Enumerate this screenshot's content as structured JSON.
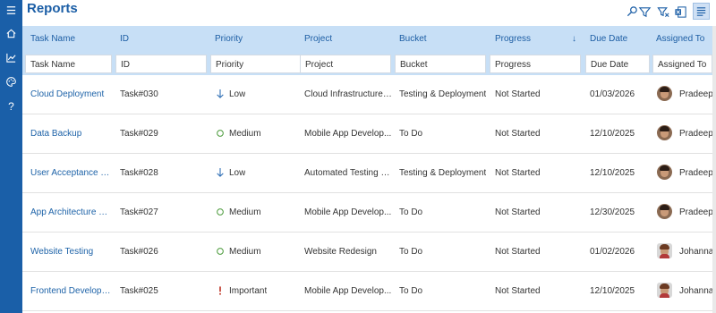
{
  "app": {
    "title": "Reports"
  },
  "rail": {
    "icons": [
      "menu-icon",
      "chart-icon",
      "palette-icon",
      "help-icon"
    ]
  },
  "toolbar": {
    "icons": [
      "search-filter-icon",
      "filter-clear-icon",
      "export-excel-icon",
      "view-toggle-icon"
    ]
  },
  "columns": [
    {
      "key": "task_name",
      "label": "Task Name",
      "filter_placeholder": "Task Name"
    },
    {
      "key": "id",
      "label": "ID",
      "filter_placeholder": "ID"
    },
    {
      "key": "priority",
      "label": "Priority",
      "filter_placeholder": "Priority"
    },
    {
      "key": "project",
      "label": "Project",
      "filter_placeholder": "Project"
    },
    {
      "key": "bucket",
      "label": "Bucket",
      "filter_placeholder": "Bucket"
    },
    {
      "key": "progress",
      "label": "Progress",
      "filter_placeholder": "Progress",
      "sort_indicator": "↓"
    },
    {
      "key": "due_date",
      "label": "Due Date",
      "filter_placeholder": "Due Date"
    },
    {
      "key": "assigned_to",
      "label": "Assigned To",
      "filter_placeholder": "Assigned To"
    }
  ],
  "colors": {
    "brand": "#1b5ea6",
    "header_bg": "#c7dff6",
    "low": "#2f6fb5",
    "medium": "#4a9a3a",
    "important": "#c0392b"
  },
  "rows": [
    {
      "task_name": "Cloud Deployment",
      "id": "Task#030",
      "priority": "Low",
      "priority_icon": "arrow-down-icon",
      "project": "Cloud Infrastructure ...",
      "bucket": "Testing & Deployment",
      "progress": "Not Started",
      "due_date": "01/03/2026",
      "assigned_to": "Pradeep C",
      "avatar": "pradeep"
    },
    {
      "task_name": "Data Backup",
      "id": "Task#029",
      "priority": "Medium",
      "priority_icon": "circle-icon",
      "project": "Mobile App Develop...",
      "bucket": "To Do",
      "progress": "Not Started",
      "due_date": "12/10/2025",
      "assigned_to": "Pradeep C",
      "avatar": "pradeep"
    },
    {
      "task_name": "User Acceptance Te...",
      "id": "Task#028",
      "priority": "Low",
      "priority_icon": "arrow-down-icon",
      "project": "Automated Testing Pl...",
      "bucket": "Testing & Deployment",
      "progress": "Not Started",
      "due_date": "12/10/2025",
      "assigned_to": "Pradeep C",
      "avatar": "pradeep"
    },
    {
      "task_name": "App Architecture Pl...",
      "id": "Task#027",
      "priority": "Medium",
      "priority_icon": "circle-icon",
      "project": "Mobile App Develop...",
      "bucket": "To Do",
      "progress": "Not Started",
      "due_date": "12/30/2025",
      "assigned_to": "Pradeep C",
      "avatar": "pradeep"
    },
    {
      "task_name": "Website Testing",
      "id": "Task#026",
      "priority": "Medium",
      "priority_icon": "circle-icon",
      "project": "Website Redesign",
      "bucket": "To Do",
      "progress": "Not Started",
      "due_date": "01/02/2026",
      "assigned_to": "Johanna L",
      "avatar": "johanna"
    },
    {
      "task_name": "Frontend Developm...",
      "id": "Task#025",
      "priority": "Important",
      "priority_icon": "exclamation-icon",
      "project": "Mobile App Develop...",
      "bucket": "To Do",
      "progress": "Not Started",
      "due_date": "12/10/2025",
      "assigned_to": "Johanna L",
      "avatar": "johanna"
    }
  ]
}
